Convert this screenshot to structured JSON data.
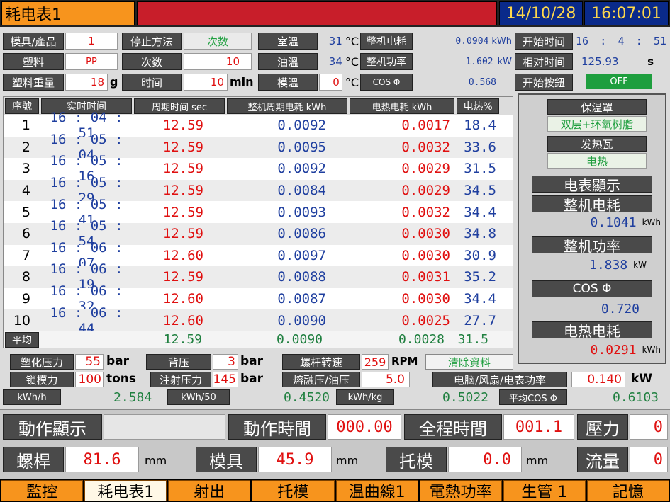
{
  "title": "耗电表1",
  "date": "14/10/28",
  "time": "16:07:01",
  "params": {
    "mold_product": "模具/產品",
    "mold_product_val": "1",
    "stop_method": "停止方法",
    "stop_method_val": "次数",
    "room_temp": "室溫",
    "room_temp_val": "31",
    "machine_energy": "整机电耗",
    "machine_energy_val": "0.0904",
    "machine_energy_unit": "kWh",
    "start_time": "开始时间",
    "start_h": "16",
    "start_m": "4",
    "start_s": "51",
    "plastic": "塑料",
    "plastic_val": "PP",
    "count": "次数",
    "count_val": "10",
    "oil_temp": "油溫",
    "oil_temp_val": "34",
    "machine_power": "整机功率",
    "machine_power_val": "1.602",
    "machine_power_unit": "kW",
    "relative_time": "相对时间",
    "relative_time_val": "125.93",
    "relative_time_unit": "s",
    "plastic_weight": "塑料重量",
    "plastic_weight_val": "18",
    "plastic_weight_unit": "g",
    "time_lbl": "时间",
    "time_val": "10",
    "time_unit": "min",
    "mold_temp": "模溫",
    "mold_temp_val": "0",
    "cos": "COS Φ",
    "cos_val": "0.568",
    "start_btn": "开始按鈕",
    "start_btn_val": "OFF",
    "deg_c": "°C"
  },
  "table": {
    "headers": [
      "序號",
      "实时时间",
      "周期时间 sec",
      "整机周期电耗 kWh",
      "电热电耗 kWh",
      "电热%"
    ],
    "rows": [
      [
        "1",
        "16 : 04 : 51",
        "12.59",
        "0.0092",
        "0.0017",
        "18.4"
      ],
      [
        "2",
        "16 : 05 : 04",
        "12.59",
        "0.0095",
        "0.0032",
        "33.6"
      ],
      [
        "3",
        "16 : 05 : 16",
        "12.59",
        "0.0092",
        "0.0029",
        "31.5"
      ],
      [
        "4",
        "16 : 05 : 29",
        "12.59",
        "0.0084",
        "0.0029",
        "34.5"
      ],
      [
        "5",
        "16 : 05 : 41",
        "12.59",
        "0.0093",
        "0.0032",
        "34.4"
      ],
      [
        "6",
        "16 : 05 : 54",
        "12.59",
        "0.0086",
        "0.0030",
        "34.8"
      ],
      [
        "7",
        "16 : 06 : 07",
        "12.60",
        "0.0097",
        "0.0030",
        "30.9"
      ],
      [
        "8",
        "16 : 06 : 19",
        "12.59",
        "0.0088",
        "0.0031",
        "35.2"
      ],
      [
        "9",
        "16 : 06 : 32",
        "12.60",
        "0.0087",
        "0.0030",
        "34.4"
      ],
      [
        "10",
        "16 : 06 : 44",
        "12.60",
        "0.0090",
        "0.0025",
        "27.7"
      ]
    ],
    "avg_label": "平均",
    "avg": [
      "12.59",
      "0.0090",
      "0.0028",
      "31.5"
    ]
  },
  "side": {
    "insulation": "保温罩",
    "insulation_val": "双层+环氧树脂",
    "heater": "发热瓦",
    "heater_val": "电热",
    "meter_display": "电表顯示",
    "machine_energy": "整机电耗",
    "machine_energy_val": "0.1041",
    "machine_energy_unit": "kWh",
    "machine_power": "整机功率",
    "machine_power_val": "1.838",
    "machine_power_unit": "kW",
    "cos": "COS Φ",
    "cos_val": "0.720",
    "heat_energy": "电热电耗",
    "heat_energy_val": "0.0291",
    "heat_energy_unit": "kWh"
  },
  "bottom": {
    "plast_pressure": "塑化压力",
    "plast_pressure_val": "55",
    "bar": "bar",
    "back_pressure": "背压",
    "back_pressure_val": "3",
    "screw_speed": "螺杆转速",
    "screw_speed_val": "259",
    "rpm": "RPM",
    "clear_data": "清除資料",
    "clamp_force": "锁模力",
    "clamp_force_val": "100",
    "tons": "tons",
    "inject_pressure": "注射压力",
    "inject_pressure_val": "145",
    "melt_oil": "熔融压/油压",
    "melt_oil_val": "5.0",
    "fan_power": "电脑/风扇/电表功率",
    "fan_power_val": "0.140",
    "kw": "kW",
    "kwh_h": "kWh/h",
    "kwh_h_val": "2.584",
    "kwh_50": "kWh/50",
    "kwh_50_val": "0.4520",
    "kwh_kg": "kWh/kg",
    "kwh_kg_val": "0.5022",
    "avg_cos": "平均COS Φ",
    "avg_cos_val": "0.6103"
  },
  "status": {
    "action_display": "動作顯示",
    "action_display_val": "",
    "action_time": "動作時間",
    "action_time_val": "000.00",
    "total_time": "全程時間",
    "total_time_val": "001.1",
    "pressure": "壓力",
    "pressure_val": "0",
    "screw": "螺桿",
    "screw_val": "81.6",
    "mm": "mm",
    "mold": "模具",
    "mold_val": "45.9",
    "ejector": "托模",
    "ejector_val": "0.0",
    "flow": "流量",
    "flow_val": "0"
  },
  "tabs": [
    "監控",
    "耗电表1",
    "射出",
    "托模",
    "温曲線1",
    "電熱功率",
    "生管 1",
    "記憶"
  ],
  "colors": {
    "title_bg": "#f7941d",
    "alarm_bar": "#c81e2a",
    "clock_bg": "#0a2a8a",
    "clock_fg": "#ffd84a",
    "tab_bg": "#f7941d"
  }
}
